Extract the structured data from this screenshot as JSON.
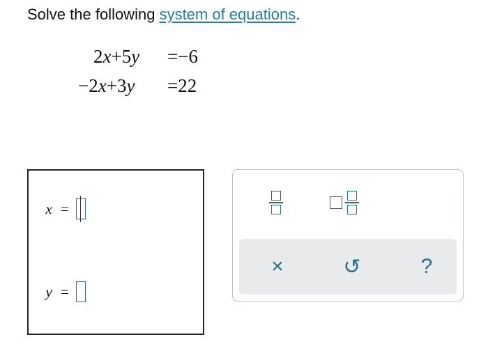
{
  "prompt": {
    "lead": "Solve the following ",
    "link": "system of equations",
    "trail": "."
  },
  "equations": [
    {
      "lhs_parts": [
        "2",
        "x",
        "+5",
        "y"
      ],
      "rhs": "=−6"
    },
    {
      "lhs_parts": [
        "−2",
        "x",
        "+3",
        "y"
      ],
      "rhs": "=22"
    }
  ],
  "answers": [
    {
      "var": "x",
      "equals": "=",
      "value": "",
      "active": true
    },
    {
      "var": "y",
      "equals": "=",
      "value": "",
      "active": false
    }
  ],
  "toolbar": {
    "fraction_icon": "fraction-icon",
    "mixed_number_icon": "mixed-number-icon",
    "clear_label": "×",
    "undo_label": "↺",
    "help_label": "?",
    "accent": "#1f7fa0"
  }
}
